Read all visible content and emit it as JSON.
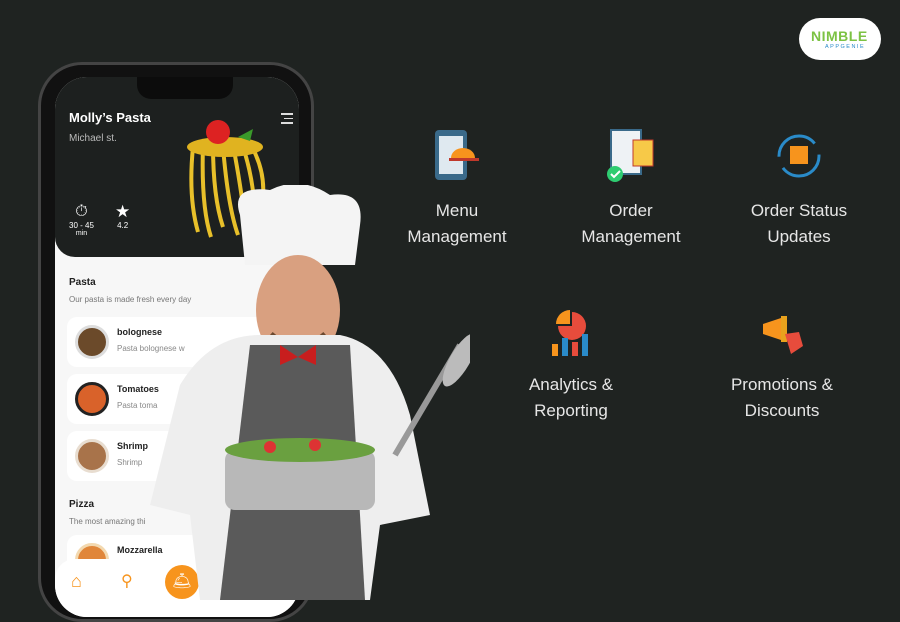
{
  "logo": {
    "text": "NIMBLE",
    "sub": "APPGENIE"
  },
  "phone": {
    "restaurant": "Molly’s Pasta",
    "street": "Michael st.",
    "time": "30 - 45",
    "time_unit": "min",
    "rating": "4.2",
    "sections": [
      {
        "title": "Pasta",
        "subtitle": "Our pasta is made fresh every day"
      },
      {
        "title": "Pizza",
        "subtitle": "The most amazing thi"
      }
    ],
    "items": [
      {
        "name": "bolognese",
        "desc": "Pasta bolognese w"
      },
      {
        "name": "Tomatoes",
        "desc": "Pasta toma"
      },
      {
        "name": "Shrimp",
        "desc": "Shrimp"
      },
      {
        "name": "Mozzarella",
        "desc": ""
      }
    ]
  },
  "features": [
    {
      "l1": "Menu",
      "l2": "Management",
      "icon": "menu-tablet-icon"
    },
    {
      "l1": "Order",
      "l2": "Management",
      "icon": "order-clipboard-icon"
    },
    {
      "l1": "Order Status",
      "l2": "Updates",
      "icon": "order-status-cycle-icon"
    },
    {
      "l1": "Analytics &",
      "l2": "Reporting",
      "icon": "analytics-chart-icon"
    },
    {
      "l1": "Promotions &",
      "l2": "Discounts",
      "icon": "megaphone-tag-icon"
    }
  ],
  "colors": {
    "accent": "#f7941d",
    "background": "#1f2321"
  }
}
